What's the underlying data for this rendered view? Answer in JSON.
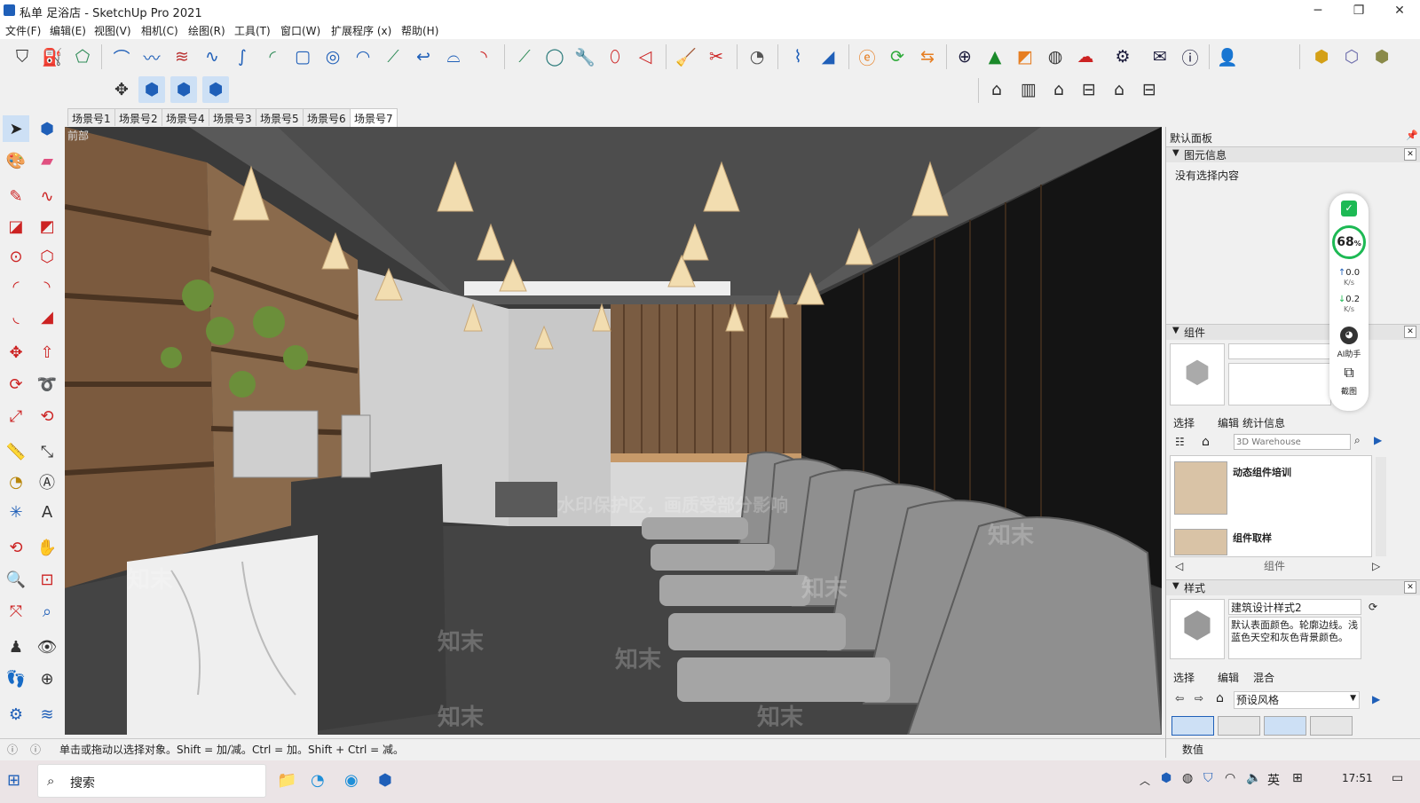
{
  "window": {
    "title": "私单 足浴店 - SketchUp Pro 2021",
    "minimize": "─",
    "maximize": "❐",
    "close": "✕"
  },
  "menu": [
    "文件(F)",
    "编辑(E)",
    "视图(V)",
    "相机(C)",
    "绘图(R)",
    "工具(T)",
    "窗口(W)",
    "扩展程序 (x)",
    "帮助(H)"
  ],
  "scenes": [
    "场景号1",
    "场景号2",
    "场景号4",
    "场景号3",
    "场景号5",
    "场景号6",
    "场景号7"
  ],
  "viewport": {
    "label": "前部"
  },
  "watermarks": {
    "brand": "知末",
    "notice": "水印保护区，画质受部分影响"
  },
  "panel": {
    "title": "默认面板",
    "entity_info": {
      "header": "图元信息",
      "content": "没有选择内容"
    },
    "components": {
      "header": "组件",
      "tabs": [
        "选择",
        "编辑",
        "统计信息"
      ],
      "search_placeholder": "3D Warehouse",
      "items": [
        "动态组件培训",
        "组件取样"
      ],
      "footer_label": "组件"
    },
    "styles": {
      "header": "样式",
      "style_name": "建筑设计样式2",
      "description": "默认表面颜色。轮廓边线。浅蓝色天空和灰色背景颜色。",
      "tabs": [
        "选择",
        "编辑",
        "混合"
      ],
      "dropdown": "预设风格"
    },
    "value_label": "数值"
  },
  "overlay_widget": {
    "percent": "68",
    "percent_unit": "%",
    "up": "0.0",
    "down": "0.2",
    "rate_unit": "K/s",
    "ai_label": "AI助手",
    "crop_label": "截图"
  },
  "status": {
    "text": "单击或拖动以选择对象。Shift = 加/减。Ctrl = 加。Shift + Ctrl = 减。"
  },
  "taskbar": {
    "search": "搜索",
    "ime": "英",
    "time": "17:51"
  },
  "colors": {
    "accent": "#1f5fb8",
    "viewport_bg": "#3a3a3a",
    "wood": "#8a6a4c",
    "sofa": "#8f8f8f",
    "green_badge": "#1db954"
  }
}
